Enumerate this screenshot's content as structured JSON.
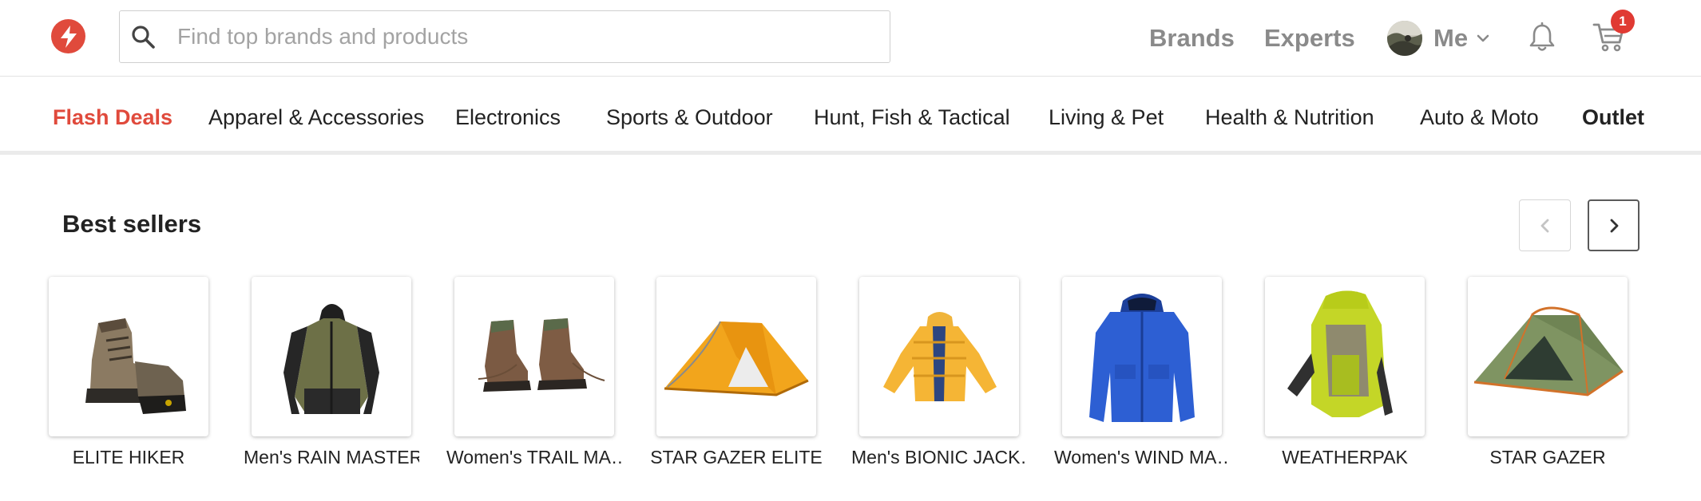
{
  "header": {
    "search_placeholder": "Find top brands and products",
    "nav": [
      "Brands",
      "Experts"
    ],
    "me_label": "Me",
    "cart_count": "1"
  },
  "categories": [
    "Flash Deals",
    "Apparel & Accessories",
    "Electronics",
    "Sports & Outdoor",
    "Hunt, Fish & Tactical",
    "Living & Pet",
    "Health & Nutrition",
    "Auto & Moto",
    "Outlet"
  ],
  "best_sellers": {
    "title": "Best sellers",
    "products": [
      {
        "label": "ELITE HIKER",
        "icon": "hiking-boot-icon"
      },
      {
        "label": "Men's RAIN MASTER",
        "icon": "rain-jacket-icon"
      },
      {
        "label": "Women's TRAIL MA…",
        "icon": "trail-boots-icon"
      },
      {
        "label": "STAR GAZER ELITE",
        "icon": "tent-icon"
      },
      {
        "label": "Men's BIONIC JACK…",
        "icon": "puffer-jacket-icon"
      },
      {
        "label": "Women's WIND MA…",
        "icon": "parka-icon"
      },
      {
        "label": "WEATHERPAK",
        "icon": "backpack-icon"
      },
      {
        "label": "STAR GAZER",
        "icon": "tent-icon"
      }
    ]
  },
  "colors": {
    "brand": "#e04a3c",
    "badge": "#e03a33",
    "nav_gray": "#8a8a8a"
  }
}
